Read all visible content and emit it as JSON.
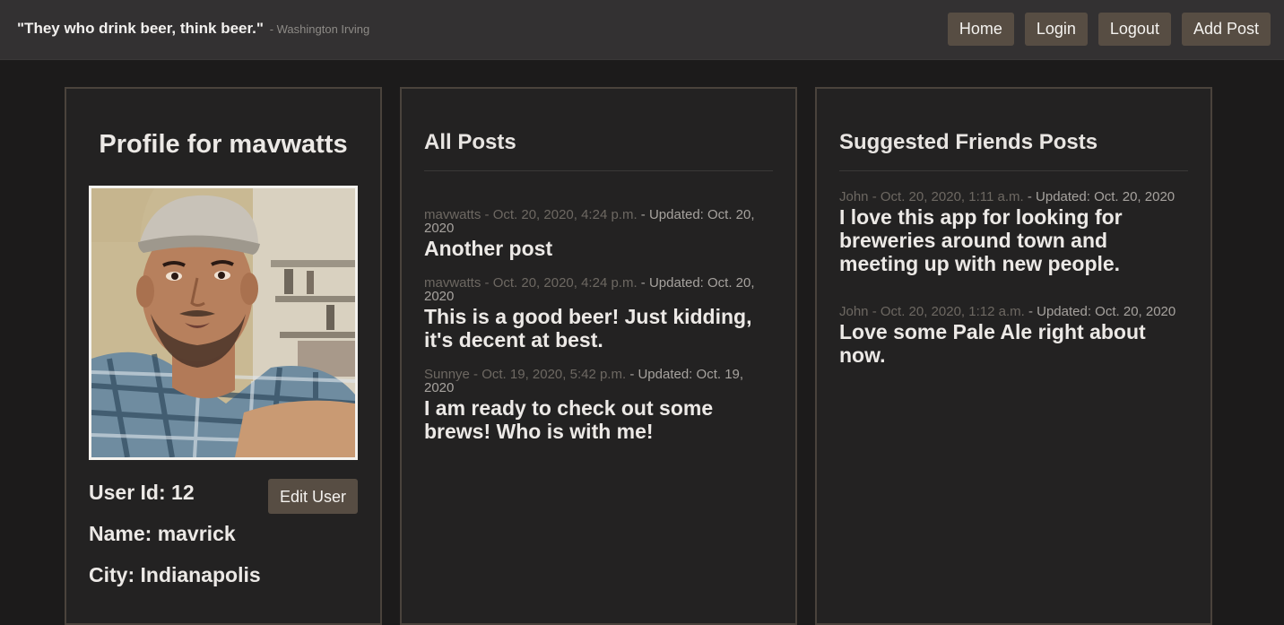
{
  "header": {
    "quote": "\"They who drink beer, think beer.\"",
    "quote_author": "- Washington Irving",
    "nav": {
      "home": "Home",
      "login": "Login",
      "logout": "Logout",
      "add_post": "Add Post"
    }
  },
  "profile": {
    "title": "Profile for mavwatts",
    "user_id": "User Id: 12",
    "name": "Name: mavrick",
    "city": "City: Indianapolis",
    "edit_button": "Edit User"
  },
  "all_posts": {
    "title": "All Posts",
    "posts": [
      {
        "author": "mavwatts",
        "date": "- Oct. 20, 2020, 4:24 p.m.",
        "updated": "- Updated: Oct. 20, 2020",
        "body": "Another post"
      },
      {
        "author": "mavwatts",
        "date": "- Oct. 20, 2020, 4:24 p.m.",
        "updated": "- Updated: Oct. 20, 2020",
        "body": "This is a good beer! Just kidding, it's decent at best."
      },
      {
        "author": "Sunnye",
        "date": "- Oct. 19, 2020, 5:42 p.m.",
        "updated": "- Updated: Oct. 19, 2020",
        "body": "I am ready to check out some brews! Who is with me!"
      }
    ]
  },
  "friends_posts": {
    "title": "Suggested Friends Posts",
    "posts": [
      {
        "author": "John",
        "date": "- Oct. 20, 2020, 1:11 a.m.",
        "updated": "- Updated: Oct. 20, 2020",
        "body": "I love this app for looking for breweries around town and meeting up with new people."
      },
      {
        "author": "John",
        "date": "- Oct. 20, 2020, 1:12 a.m.",
        "updated": "- Updated: Oct. 20, 2020",
        "body": "Love some Pale Ale right about now."
      }
    ]
  }
}
